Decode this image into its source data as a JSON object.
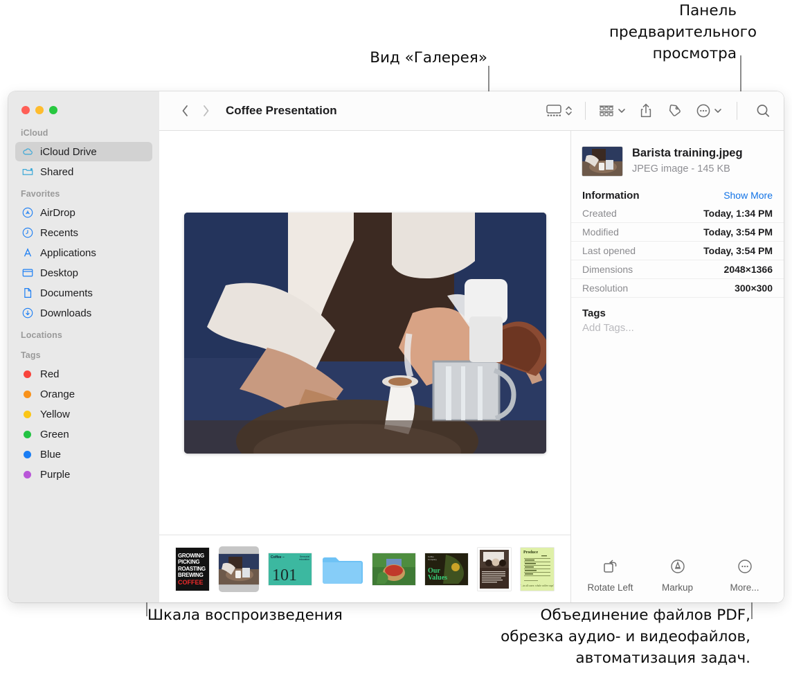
{
  "annotations": {
    "gallery_view": "Вид «Галерея»",
    "preview_panel": "Панель\nпредварительного\nпросмотра",
    "scrubber": "Шкала воспроизведения",
    "more_actions": "Объединение файлов PDF,\nобрезка аудио- и видеофайлов,\nавтоматизация задач."
  },
  "window": {
    "title": "Coffee Presentation"
  },
  "toolbar": {
    "back_icon": "chevron-left-icon",
    "forward_icon": "chevron-right-icon",
    "view_icon": "gallery-view-icon",
    "view_stepper_icon": "up-down-chevron-icon",
    "group_icon": "group-by-icon",
    "group_chevron_icon": "chevron-down-icon",
    "share_icon": "share-icon",
    "tag_icon": "tag-icon",
    "more_icon": "ellipsis-circle-icon",
    "more_chevron_icon": "chevron-down-icon",
    "search_icon": "search-icon"
  },
  "sidebar": {
    "sections": [
      {
        "title": "iCloud",
        "items": [
          {
            "label": "iCloud Drive",
            "icon": "icloud-icon",
            "selected": true
          },
          {
            "label": "Shared",
            "icon": "shared-folder-icon",
            "selected": false
          }
        ]
      },
      {
        "title": "Favorites",
        "items": [
          {
            "label": "AirDrop",
            "icon": "airdrop-icon",
            "selected": false
          },
          {
            "label": "Recents",
            "icon": "clock-icon",
            "selected": false
          },
          {
            "label": "Applications",
            "icon": "applications-icon",
            "selected": false
          },
          {
            "label": "Desktop",
            "icon": "desktop-icon",
            "selected": false
          },
          {
            "label": "Documents",
            "icon": "document-icon",
            "selected": false
          },
          {
            "label": "Downloads",
            "icon": "downloads-icon",
            "selected": false
          }
        ]
      },
      {
        "title": "Locations",
        "items": []
      },
      {
        "title": "Tags",
        "items": [
          {
            "label": "Red",
            "icon": "tag-dot-icon",
            "color": "#f8443c"
          },
          {
            "label": "Orange",
            "icon": "tag-dot-icon",
            "color": "#f8921b"
          },
          {
            "label": "Yellow",
            "icon": "tag-dot-icon",
            "color": "#fbc617"
          },
          {
            "label": "Green",
            "icon": "tag-dot-icon",
            "color": "#23c343"
          },
          {
            "label": "Blue",
            "icon": "tag-dot-icon",
            "color": "#1b7ef4"
          },
          {
            "label": "Purple",
            "icon": "tag-dot-icon",
            "color": "#b957d8"
          }
        ]
      }
    ]
  },
  "preview": {
    "file_name": "Barista training.jpeg",
    "file_sub": "JPEG image - 145 KB",
    "information_title": "Information",
    "show_more": "Show More",
    "rows": [
      {
        "key": "Created",
        "value": "Today, 1:34 PM"
      },
      {
        "key": "Modified",
        "value": "Today, 3:54 PM"
      },
      {
        "key": "Last opened",
        "value": "Today, 3:54 PM"
      },
      {
        "key": "Dimensions",
        "value": "2048×1366"
      },
      {
        "key": "Resolution",
        "value": "300×300"
      }
    ],
    "tags_title": "Tags",
    "tags_placeholder": "Add Tags...",
    "actions": [
      {
        "label": "Rotate Left",
        "icon": "rotate-left-icon"
      },
      {
        "label": "Markup",
        "icon": "markup-icon"
      },
      {
        "label": "More...",
        "icon": "ellipsis-circle-icon"
      }
    ]
  },
  "filmstrip": {
    "items": [
      {
        "name": "coffee-poster-thumb",
        "selected": false
      },
      {
        "name": "barista-training-thumb",
        "selected": true
      },
      {
        "name": "coffee-101-thumb",
        "selected": false
      },
      {
        "name": "folder-thumb",
        "selected": false
      },
      {
        "name": "cherry-harvest-thumb",
        "selected": false
      },
      {
        "name": "our-values-thumb",
        "selected": false
      },
      {
        "name": "meeting-doc-thumb",
        "selected": false
      },
      {
        "name": "produce-list-thumb",
        "selected": false
      }
    ],
    "poster_lines": [
      "GROWING",
      "PICKING",
      "ROASTING",
      "BREWING",
      "COFFEE"
    ],
    "coffee_101_label": "101",
    "coffee_101_small": "Coffee",
    "our_values_label": "Our\nValues",
    "produce_label": "Produce"
  },
  "colors": {
    "accent_blue": "#1273e6",
    "sidebar_bg": "#e9e9e9",
    "selected_row": "#d2d2d2"
  }
}
